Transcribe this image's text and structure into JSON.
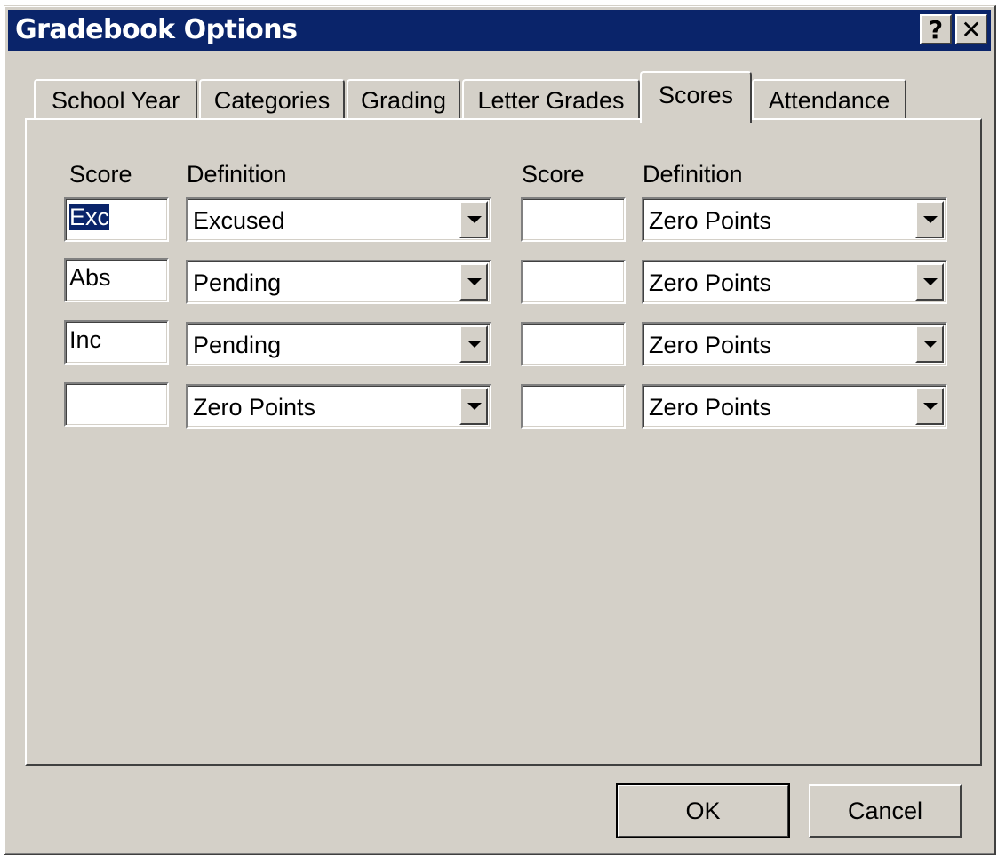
{
  "window": {
    "title": "Gradebook Options",
    "help_label": "?",
    "close_label": "✕"
  },
  "tabs": [
    {
      "label": "School Year"
    },
    {
      "label": "Categories"
    },
    {
      "label": "Grading"
    },
    {
      "label": "Letter Grades"
    },
    {
      "label": "Scores"
    },
    {
      "label": "Attendance"
    }
  ],
  "active_tab": "Scores",
  "columns": {
    "score_label": "Score",
    "definition_label": "Definition"
  },
  "left_rows": [
    {
      "score": "Exc",
      "definition": "Excused"
    },
    {
      "score": "Abs",
      "definition": "Pending"
    },
    {
      "score": "Inc",
      "definition": "Pending"
    },
    {
      "score": "",
      "definition": "Zero Points"
    }
  ],
  "right_rows": [
    {
      "score": "",
      "definition": "Zero Points"
    },
    {
      "score": "",
      "definition": "Zero Points"
    },
    {
      "score": "",
      "definition": "Zero Points"
    },
    {
      "score": "",
      "definition": "Zero Points"
    }
  ],
  "buttons": {
    "ok": "OK",
    "cancel": "Cancel"
  },
  "colors": {
    "title_bar": "#0a246a",
    "face": "#d4d0c8",
    "selection": "#0a246a"
  }
}
